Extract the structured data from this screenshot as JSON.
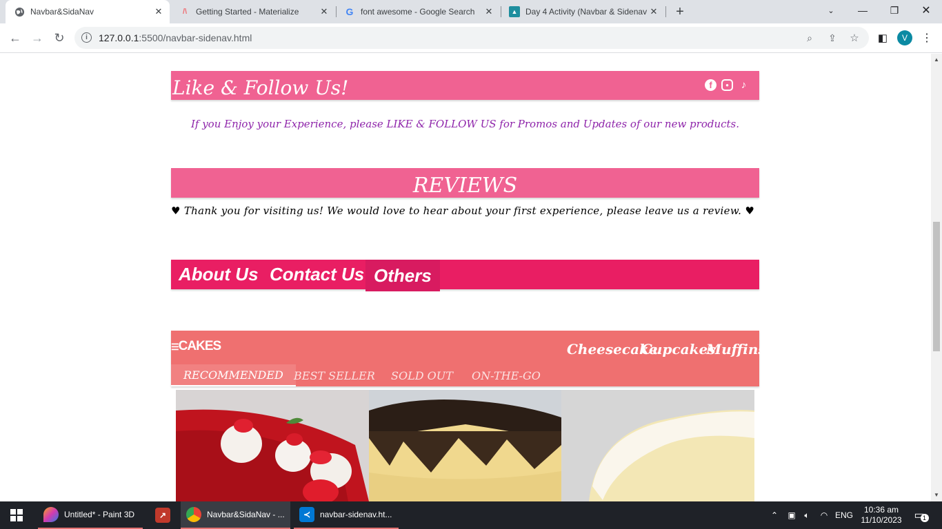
{
  "browser": {
    "tabs": [
      {
        "title": "Navbar&SidaNav",
        "icon": "globe-icon",
        "active": true
      },
      {
        "title": "Getting Started - Materialize",
        "icon": "materialize-icon",
        "active": false
      },
      {
        "title": "font awesome - Google Search",
        "icon": "google-icon",
        "active": false
      },
      {
        "title": "Day 4 Activity (Navbar & Sidenav",
        "icon": "classroom-icon",
        "active": false
      }
    ],
    "new_tab": "+",
    "url_host": "127.0.0.1",
    "url_path": ":5500/navbar-sidenav.html",
    "profile_initial": "V"
  },
  "page": {
    "follow_heading": "Like & Follow Us!",
    "follow_text": "If you Enjoy your Experience, please LIKE & FOLLOW US for Promos and Updates of our new products.",
    "social": [
      "facebook-icon",
      "instagram-icon",
      "tiktok-icon"
    ],
    "reviews_heading": "REVIEWS",
    "reviews_text": "♥ Thank you for visiting us! We would love to hear about your first experience, please leave us a review. ♥",
    "nav_links": [
      "About Us",
      "Contact Us",
      "Others"
    ],
    "cakes_brand": "CAKES",
    "cakes_menu": [
      "Cheesecake",
      "Cupcakes",
      "Muffins"
    ],
    "cakes_tabs": [
      "RECOMMENDED",
      "BEST SELLER",
      "SOLD OUT",
      "ON-THE-GO"
    ]
  },
  "taskbar": {
    "apps": [
      {
        "label": "Untitled* - Paint 3D",
        "icon": "paint3d-icon"
      },
      {
        "label": "",
        "icon": "app-icon"
      },
      {
        "label": "Navbar&SidaNav - ...",
        "icon": "chrome-icon"
      },
      {
        "label": "navbar-sidenav.ht...",
        "icon": "vscode-icon"
      }
    ],
    "language": "ENG",
    "time": "10:36 am",
    "date": "11/10/2023",
    "notifications": "1"
  },
  "colors": {
    "pink_band": "#f06292",
    "navbar": "#e91e63",
    "cakes_bar": "#ef7070",
    "follow_text": "#8e24aa"
  }
}
